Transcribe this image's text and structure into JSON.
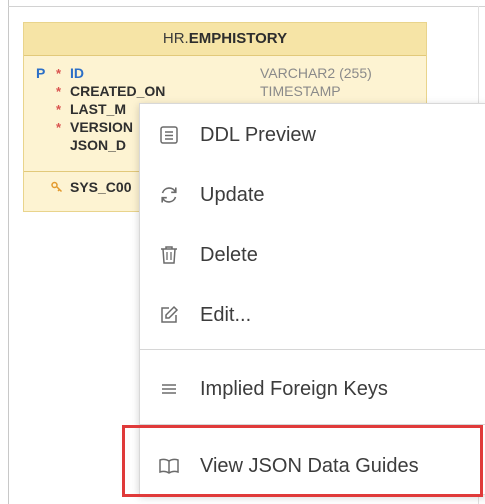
{
  "entity": {
    "schema": "HR.",
    "name": "EMPHISTORY",
    "columns": [
      {
        "pk": "P",
        "required": "*",
        "name": "ID",
        "type": "VARCHAR2 (255)"
      },
      {
        "pk": "",
        "required": "*",
        "name": "CREATED_ON",
        "type": "TIMESTAMP"
      },
      {
        "pk": "",
        "required": "*",
        "name": "LAST_M",
        "type": ""
      },
      {
        "pk": "",
        "required": "*",
        "name": "VERSION",
        "type": ""
      },
      {
        "pk": "",
        "required": "",
        "name": "JSON_D",
        "type": ""
      }
    ],
    "constraint": "SYS_C00"
  },
  "context_menu": {
    "items": [
      {
        "label": "DDL Preview",
        "icon": "ddl-preview-icon"
      },
      {
        "label": "Update",
        "icon": "refresh-icon"
      },
      {
        "label": "Delete",
        "icon": "trash-icon"
      },
      {
        "label": "Edit...",
        "icon": "edit-icon"
      },
      {
        "label": "Implied Foreign Keys",
        "icon": "list-icon"
      },
      {
        "label": "View JSON Data Guides",
        "icon": "book-icon"
      }
    ]
  },
  "colors": {
    "highlight": "#e03a3a",
    "entity_bg": "#fdf3d2",
    "entity_header": "#f6e4a6",
    "pk_blue": "#2c6fc7",
    "required_red": "#d9534f"
  }
}
